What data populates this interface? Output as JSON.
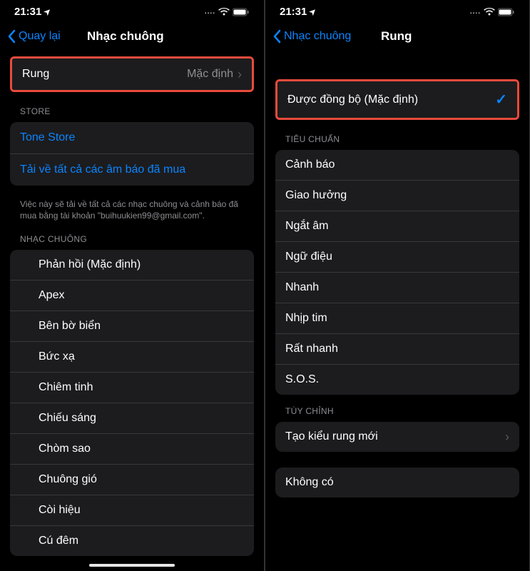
{
  "status": {
    "time": "21:31",
    "dots": "....",
    "location_icon": "➤"
  },
  "left": {
    "nav": {
      "back": "Quay lại",
      "title": "Nhạc chuông"
    },
    "rung": {
      "label": "Rung",
      "value": "Mặc định"
    },
    "store": {
      "header": "STORE",
      "tone_store": "Tone Store",
      "download": "Tải về tất cả các âm báo đã mua",
      "footer": "Việc này sẽ tải về tất cả các nhạc chuông và cảnh báo đã mua bằng tài khoản \"buihuukien99@gmail.com\"."
    },
    "ringtones": {
      "header": "NHẠC CHUÔNG",
      "items": [
        "Phản hồi (Mặc định)",
        "Apex",
        "Bên bờ biển",
        "Bức xạ",
        "Chiêm tinh",
        "Chiếu sáng",
        "Chòm sao",
        "Chuông gió",
        "Còi hiệu",
        "Cú đêm"
      ]
    }
  },
  "right": {
    "nav": {
      "back": "Nhạc chuông",
      "title": "Rung"
    },
    "selected": {
      "label": "Được đồng bộ (Mặc định)"
    },
    "standard": {
      "header": "TIÊU CHUẨN",
      "items": [
        "Cảnh báo",
        "Giao hưởng",
        "Ngắt âm",
        "Ngữ điệu",
        "Nhanh",
        "Nhịp tim",
        "Rất nhanh",
        "S.O.S."
      ]
    },
    "custom": {
      "header": "TÙY CHỈNH",
      "create": "Tạo kiểu rung mới"
    },
    "none": {
      "label": "Không có"
    }
  }
}
